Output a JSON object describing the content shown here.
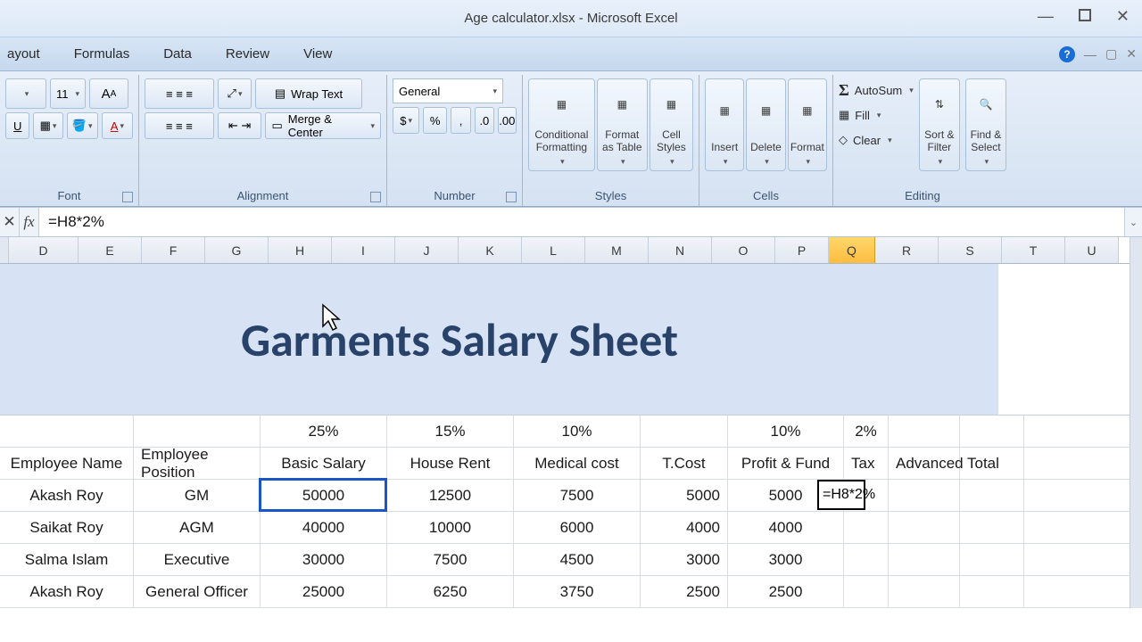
{
  "window": {
    "title": "Age calculator.xlsx - Microsoft Excel"
  },
  "tabs": [
    "ayout",
    "Formulas",
    "Data",
    "Review",
    "View"
  ],
  "ribbon": {
    "font_size": "11",
    "wrap_text": "Wrap Text",
    "merge_center": "Merge & Center",
    "number_format": "General",
    "groups": {
      "font": "Font",
      "alignment": "Alignment",
      "number": "Number",
      "styles": "Styles",
      "cells": "Cells",
      "editing": "Editing"
    },
    "styles": {
      "conditional": "Conditional Formatting",
      "format_table": "Format as Table",
      "cell_styles": "Cell Styles"
    },
    "cells": {
      "insert": "Insert",
      "delete": "Delete",
      "format": "Format"
    },
    "editing": {
      "autosum": "AutoSum",
      "fill": "Fill",
      "clear": "Clear",
      "sort_filter": "Sort & Filter",
      "find_select": "Find & Select"
    }
  },
  "formula_bar": {
    "value": "=H8*2%"
  },
  "columns": [
    "D",
    "E",
    "F",
    "G",
    "H",
    "I",
    "J",
    "K",
    "L",
    "M",
    "N",
    "O",
    "P",
    "Q",
    "R",
    "S",
    "T",
    "U"
  ],
  "active_column": "Q",
  "sheet": {
    "title": "Garments Salary Sheet",
    "percent_row": {
      "basic": "25%",
      "rent": "15%",
      "med": "10%",
      "pf": "10%",
      "tax": "2%"
    },
    "headers": {
      "name": "Employee Name",
      "position": "Employee Position",
      "basic": "Basic Salary",
      "rent": "House Rent",
      "med": "Medical cost",
      "tcost": "T.Cost",
      "pf": "Profit & Fund",
      "tax": "Tax",
      "adv": "Advanced",
      "total": "Total"
    },
    "rows": [
      {
        "name": "Akash Roy",
        "position": "GM",
        "basic": "50000",
        "rent": "12500",
        "med": "7500",
        "tcost": "5000",
        "pf": "5000",
        "tax": "=H8*2%"
      },
      {
        "name": "Saikat Roy",
        "position": "AGM",
        "basic": "40000",
        "rent": "10000",
        "med": "6000",
        "tcost": "4000",
        "pf": "4000",
        "tax": ""
      },
      {
        "name": "Salma Islam",
        "position": "Executive",
        "basic": "30000",
        "rent": "7500",
        "med": "4500",
        "tcost": "3000",
        "pf": "3000",
        "tax": ""
      },
      {
        "name": "Akash Roy",
        "position": "General Officer",
        "basic": "25000",
        "rent": "6250",
        "med": "3750",
        "tcost": "2500",
        "pf": "2500",
        "tax": ""
      }
    ]
  }
}
